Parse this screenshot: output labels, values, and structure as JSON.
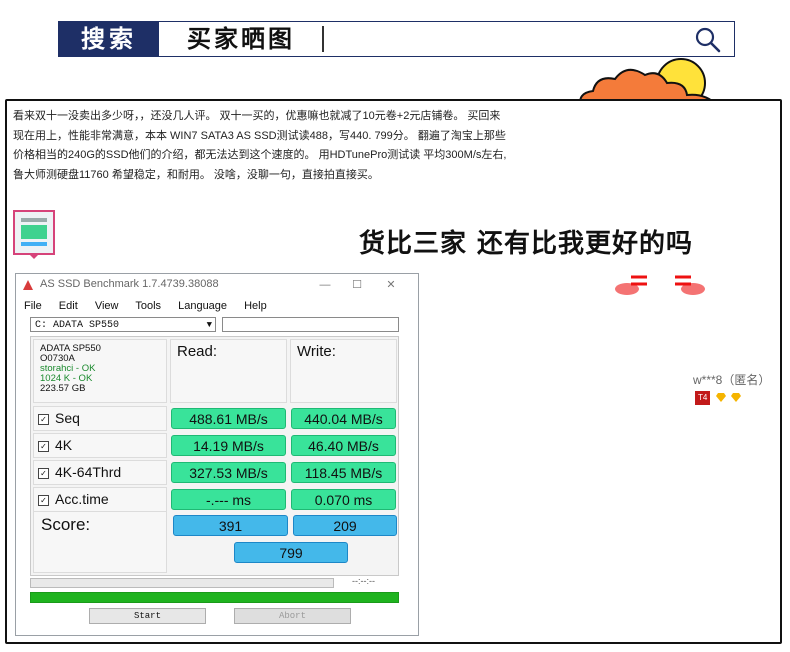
{
  "banner": {
    "tag": "搜索",
    "query": "买家晒图"
  },
  "review": {
    "text": "看来双十一没卖出多少呀，，还没几人评。 双十一买的，优惠嘛也就减了10元卷+2元店铺卷。 买回来现在用上，性能非常满意，本本 WIN7 SATA3 AS SSD测试读488，写440. 799分。 翻遍了淘宝上那些价格相当的240G的SSD他们的介绍，都无法达到这个速度的。 用HDTunePro测试读 平均300M/s左右, 鲁大师测硬盘11760 希望稳定，和耐用。 没啥，没聊一句，直接拍直接买。",
    "slogan": "货比三家 还有比我更好的吗",
    "user": "w***8（匿名）",
    "level": "T4"
  },
  "benchmark": {
    "title": "AS SSD Benchmark 1.7.4739.38088",
    "menu": [
      "File",
      "Edit",
      "View",
      "Tools",
      "Language",
      "Help"
    ],
    "drive": "C: ADATA SP550",
    "info": {
      "model": "ADATA SP550",
      "firmware": "O0730A",
      "driver": "storahci - OK",
      "align": "1024 K - OK",
      "size": "223.57 GB"
    },
    "read_label": "Read:",
    "write_label": "Write:",
    "rows": [
      {
        "label": "Seq",
        "read": "488.61 MB/s",
        "write": "440.04 MB/s"
      },
      {
        "label": "4K",
        "read": "14.19 MB/s",
        "write": "46.40 MB/s"
      },
      {
        "label": "4K-64Thrd",
        "read": "327.53 MB/s",
        "write": "118.45 MB/s"
      },
      {
        "label": "Acc.time",
        "read": "-.--- ms",
        "write": "0.070 ms"
      }
    ],
    "score_label": "Score:",
    "score_read": "391",
    "score_write": "209",
    "score_total": "799",
    "timer": "--:--:--",
    "progress_total": 1.0,
    "start": "Start",
    "abort": "Abort",
    "colors": {
      "value_green": "#39e39a",
      "score_blue": "#44b8ea",
      "progress_green": "#1fb31f",
      "banner_navy": "#1e2f66"
    }
  }
}
